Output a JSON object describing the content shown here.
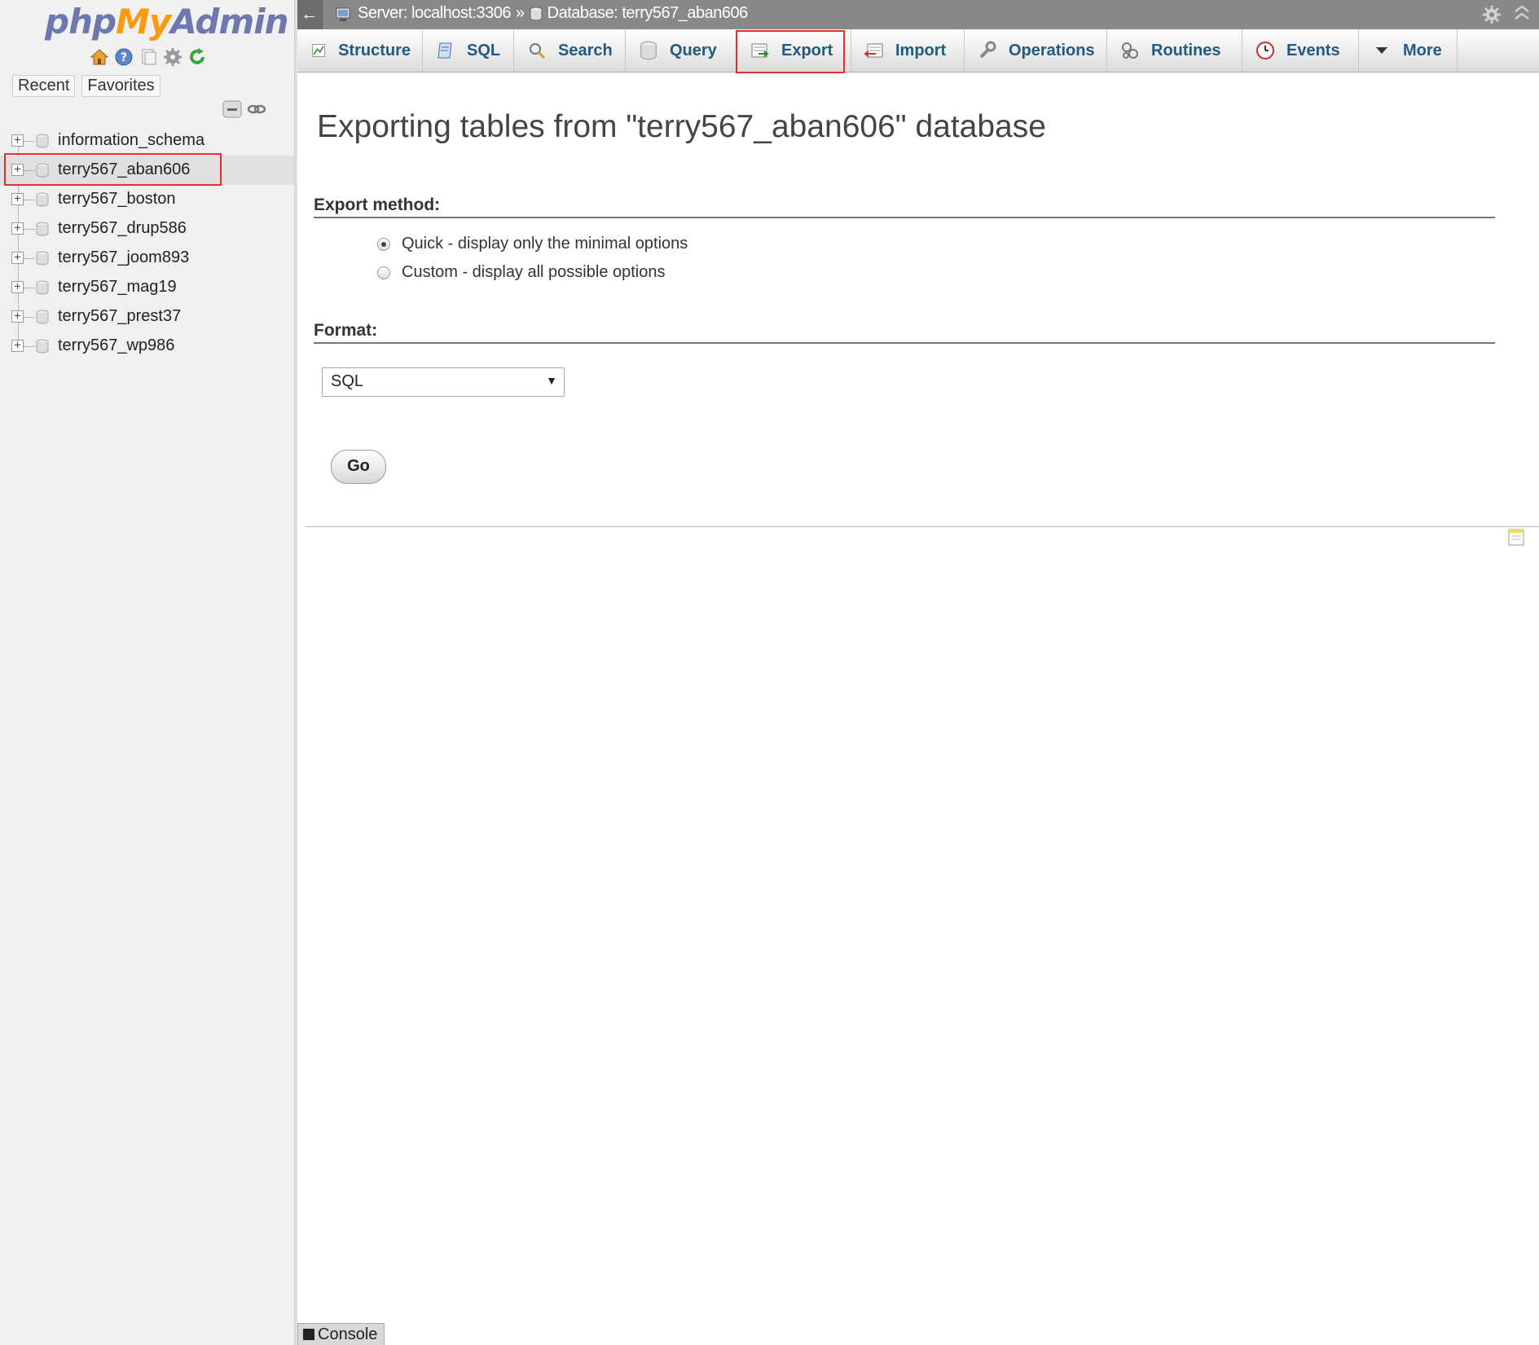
{
  "app": {
    "logo": {
      "php": "php",
      "my": "My",
      "admin": "Admin"
    },
    "icons": {
      "home": "home-icon",
      "help": "help-icon",
      "docs": "docs-icon",
      "settings": "settings-icon",
      "reload": "reload-icon"
    }
  },
  "sidebar": {
    "tabs": {
      "recent": "Recent",
      "favorites": "Favorites"
    },
    "databases": [
      {
        "name": "information_schema",
        "selected": false
      },
      {
        "name": "terry567_aban606",
        "selected": true
      },
      {
        "name": "terry567_boston",
        "selected": false
      },
      {
        "name": "terry567_drup586",
        "selected": false
      },
      {
        "name": "terry567_joom893",
        "selected": false
      },
      {
        "name": "terry567_mag19",
        "selected": false
      },
      {
        "name": "terry567_prest37",
        "selected": false
      },
      {
        "name": "terry567_wp986",
        "selected": false
      }
    ]
  },
  "topbar": {
    "back": "←",
    "server": "Server: localhost:3306",
    "separator": "»",
    "database": "Database: terry567_aban606"
  },
  "tabs": [
    {
      "label": "Structure",
      "icon": "structure-icon"
    },
    {
      "label": "SQL",
      "icon": "sql-icon"
    },
    {
      "label": "Search",
      "icon": "search-icon"
    },
    {
      "label": "Query",
      "icon": "query-icon"
    },
    {
      "label": "Export",
      "icon": "export-icon",
      "highlighted": true
    },
    {
      "label": "Import",
      "icon": "import-icon"
    },
    {
      "label": "Operations",
      "icon": "operations-icon"
    },
    {
      "label": "Routines",
      "icon": "routines-icon"
    },
    {
      "label": "Events",
      "icon": "events-icon"
    },
    {
      "label": "More",
      "icon": "more-dropdown-icon"
    }
  ],
  "main": {
    "title": "Exporting tables from \"terry567_aban606\" database",
    "export_method": {
      "heading": "Export method:",
      "options": [
        {
          "label": "Quick - display only the minimal options",
          "checked": true
        },
        {
          "label": "Custom - display all possible options",
          "checked": false
        }
      ]
    },
    "format": {
      "heading": "Format:",
      "selected": "SQL"
    },
    "go_button": "Go"
  },
  "console": {
    "label": "Console"
  },
  "colors": {
    "highlight": "#e03030",
    "tab_text": "#235a81",
    "topbar": "#888888"
  }
}
